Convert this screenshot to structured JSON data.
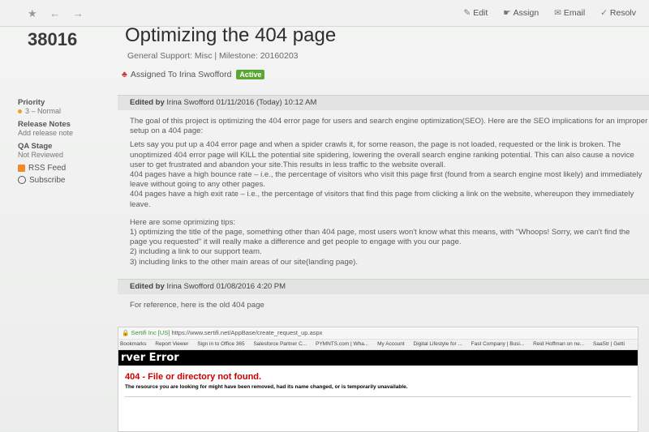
{
  "toolbar": {
    "nav_icons": "★ ← →",
    "actions": [
      {
        "icon": "✎",
        "label": "Edit"
      },
      {
        "icon": "☛",
        "label": "Assign"
      },
      {
        "icon": "✉",
        "label": "Email"
      },
      {
        "icon": "✓",
        "label": "Resolv"
      }
    ]
  },
  "ticket": {
    "id": "38016",
    "title": "Optimizing the 404 page",
    "meta": "General Support: Misc | Milestone: 20160203",
    "assigned": "Assigned To Irina Swofford",
    "status": "Active"
  },
  "sidebar": {
    "priority_label": "Priority",
    "priority_value": "3 – Normal",
    "release_label": "Release Notes",
    "release_value": "Add release note",
    "qa_label": "QA Stage",
    "qa_value": "Not Reviewed",
    "rss": "RSS Feed",
    "subscribe": "Subscribe"
  },
  "comments": [
    {
      "author_prefix": "Edited by",
      "author": "Irina Swofford 01/11/2016 (Today) 10:12 AM",
      "paragraphs": [
        "The goal of this project is optimizing the 404 error page for users and search engine optimization(SEO). Here are the SEO implications for an improper setup on a 404 page:",
        "Lets say you put up a 404 error page and when a spider crawls it, for some reason, the page is not loaded, requested or the link is broken. The unoptimized 404 error page will KILL the potential site spidering, lowering the overall search engine ranking potential. This can also cause a novice user to get frustrated and abandon your site.This results in less traffic to the website overall.",
        "404 pages have a high bounce rate – i.e., the percentage of visitors who visit this page first (found from a search engine most likely) and immediately leave without going to any other pages.",
        "404 pages have a high exit rate – i.e., the percentage of visitors that find this page from clicking a link on the website, whereupon they immediately leave.",
        "Here are some oprimizing tips:",
        "1) optimizing the title of the page, something other than 404 page, most users won't know what this means, with \"Whoops! Sorry, we can't find the page you requested\" it will really make a difference and get people to engage with you our page.",
        "2) including a link to our support team.",
        "3) including links to the other main areas of our site(landing page)."
      ]
    },
    {
      "author_prefix": "Edited by",
      "author": "Irina Swofford 01/08/2016 4:20 PM",
      "paragraphs": [
        "For reference, here is the old 404 page"
      ]
    }
  ],
  "screenshot": {
    "url_secure": "Sertifi Inc [US]",
    "url": "https://www.sertifi.net/AppBase/create_request_up.aspx",
    "bookmarks": [
      "Bookmarks",
      "Report Viewer",
      "Sign in to Office 365",
      "Salesforce Partner C...",
      "PYMNTS.com | Wha...",
      "My Account",
      "Digital Lifestyle for ...",
      "Fast Company | Busi...",
      "Reid Hoffman on ne...",
      "SaaStr | Getti"
    ],
    "error_banner": "rver Error",
    "error_title": "404 - File or directory not found.",
    "error_desc": "The resource you are looking for might have been removed, had its name changed, or is temporarily unavailable."
  }
}
